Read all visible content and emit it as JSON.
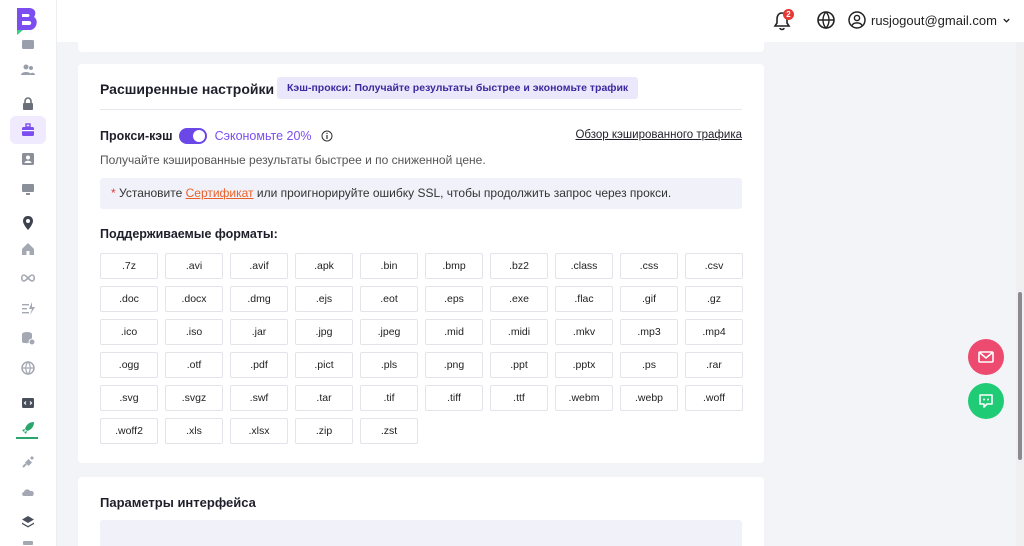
{
  "colors": {
    "accent": "#6c47e8",
    "link_orange": "#e8612c",
    "mail_fab": "#ec4a6e",
    "chat_fab": "#1fcb75",
    "badge": "#e53935"
  },
  "sidebar": {
    "icons": [
      "folder-icon",
      "users-icon",
      "lock-icon",
      "briefcase-icon",
      "id-card-icon",
      "monitor-icon",
      "location-pin-icon",
      "home-icon",
      "infinity-icon",
      "lightning-icon",
      "database-icon",
      "globe-network-icon",
      "code-window-icon",
      "rocket-icon",
      "satellite-icon",
      "cloud-icon",
      "layers-icon"
    ]
  },
  "header": {
    "notification_count": "2",
    "user_email": "rusjogout@gmail.com"
  },
  "advanced": {
    "title": "Расширенные настройки",
    "promo": "Кэш-прокси: Получайте результаты быстрее и экономьте трафик",
    "proxy_cache_label": "Прокси-кэш",
    "proxy_cache_enabled": true,
    "save_text": "Сэкономьте 20%",
    "overview_link": "Обзор кэшированного трафика",
    "description": "Получайте кэшированные результаты быстрее и по сниженной цене.",
    "notice": {
      "star": "*",
      "before": " Установите ",
      "link": "Сертификат",
      "after": " или проигнорируйте ошибку SSL, чтобы продолжить запрос через прокси."
    },
    "formats_title": "Поддерживаемые форматы:",
    "formats": [
      ".7z",
      ".avi",
      ".avif",
      ".apk",
      ".bin",
      ".bmp",
      ".bz2",
      ".class",
      ".css",
      ".csv",
      ".doc",
      ".docx",
      ".dmg",
      ".ejs",
      ".eot",
      ".eps",
      ".exe",
      ".flac",
      ".gif",
      ".gz",
      ".ico",
      ".iso",
      ".jar",
      ".jpg",
      ".jpeg",
      ".mid",
      ".midi",
      ".mkv",
      ".mp3",
      ".mp4",
      ".ogg",
      ".otf",
      ".pdf",
      ".pict",
      ".pls",
      ".png",
      ".ppt",
      ".pptx",
      ".ps",
      ".rar",
      ".svg",
      ".svgz",
      ".swf",
      ".tar",
      ".tif",
      ".tiff",
      ".ttf",
      ".webm",
      ".webp",
      ".woff",
      ".woff2",
      ".xls",
      ".xlsx",
      ".zip",
      ".zst"
    ]
  },
  "interface": {
    "title": "Параметры интерфейса"
  }
}
